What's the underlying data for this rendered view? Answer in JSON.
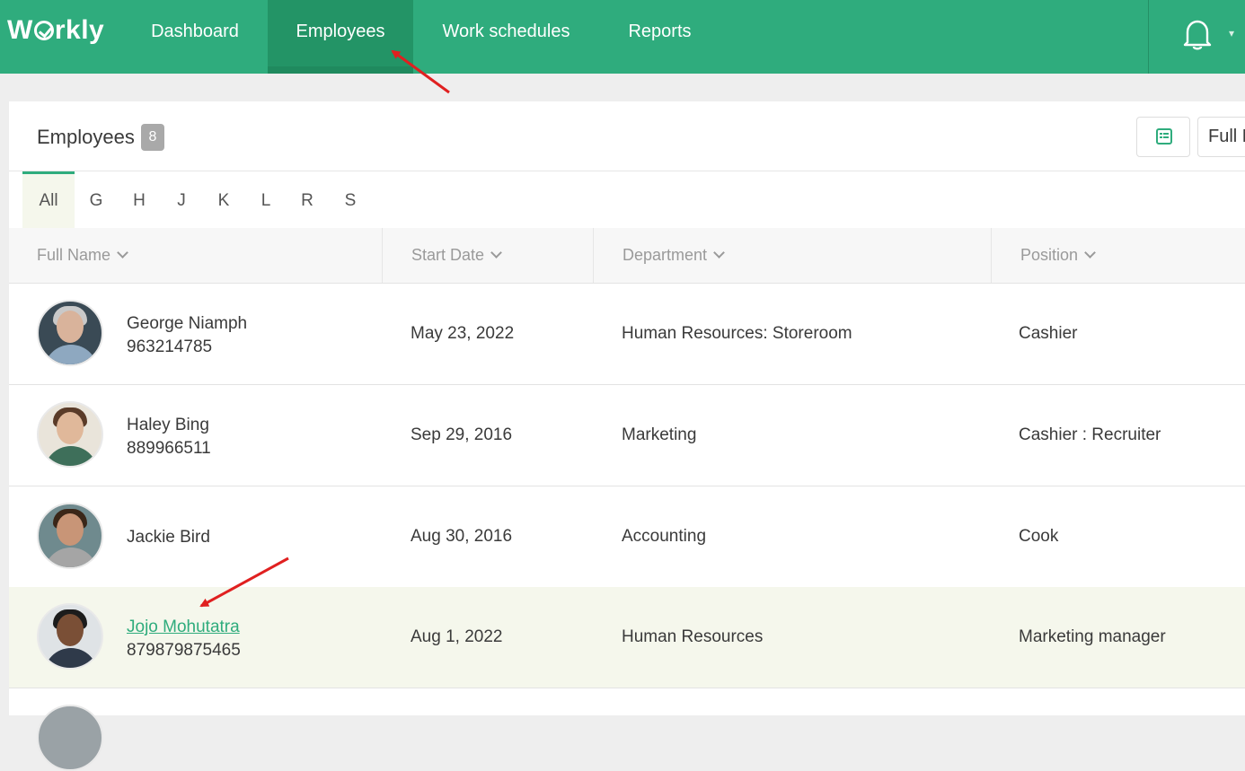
{
  "nav": {
    "logo": "Wrkly",
    "items": [
      {
        "label": "Dashboard",
        "active": false
      },
      {
        "label": "Employees",
        "active": true
      },
      {
        "label": "Work schedules",
        "active": false
      },
      {
        "label": "Reports",
        "active": false
      }
    ]
  },
  "header": {
    "title": "Employees",
    "count": "8",
    "sort_label": "Full Name"
  },
  "letters": [
    "All",
    "G",
    "H",
    "J",
    "K",
    "L",
    "R",
    "S"
  ],
  "columns": [
    "Full Name",
    "Start Date",
    "Department",
    "Position"
  ],
  "rows": [
    {
      "name": "George Niamph",
      "phone": "963214785",
      "start": "May 23, 2022",
      "department": "Human Resources: Storeroom",
      "position": "Cashier"
    },
    {
      "name": "Haley Bing",
      "phone": "889966511",
      "start": "Sep 29, 2016",
      "department": "Marketing",
      "position": "Cashier : Recruiter"
    },
    {
      "name": "Jackie Bird",
      "phone": "",
      "start": "Aug 30, 2016",
      "department": "Accounting",
      "position": "Cook"
    },
    {
      "name": "Jojo Mohutatra",
      "phone": "879879875465",
      "start": "Aug 1, 2022",
      "department": "Human Resources",
      "position": "Marketing manager"
    }
  ],
  "colors": {
    "brand": "#2fac7d",
    "brand_dark": "#239466",
    "highlight_row": "#f5f7ec",
    "annotation": "#e02020"
  }
}
